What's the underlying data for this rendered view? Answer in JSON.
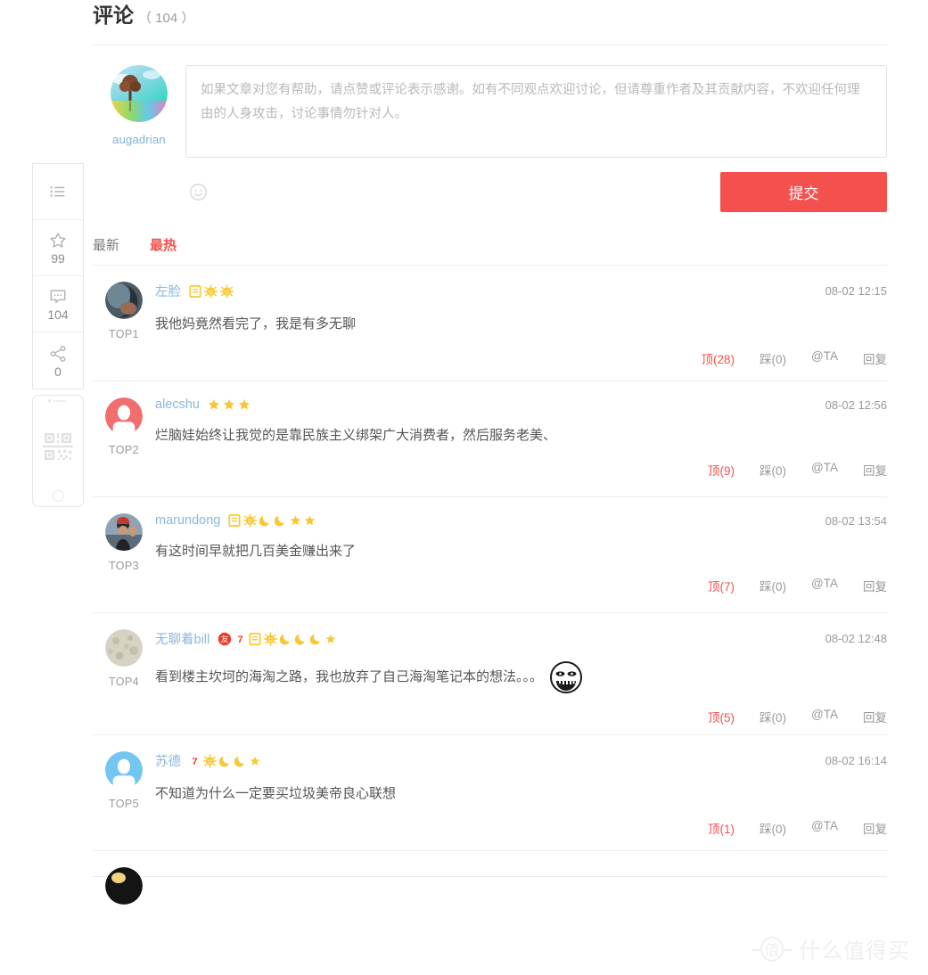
{
  "sidebar": {
    "items": [
      {
        "name": "catalog",
        "icon": "list-icon",
        "count": ""
      },
      {
        "name": "favorite",
        "icon": "star-icon",
        "count": "99"
      },
      {
        "name": "comment",
        "icon": "comment-icon",
        "count": "104"
      },
      {
        "name": "share",
        "icon": "share-icon",
        "count": "0"
      }
    ],
    "phone_widget": {
      "icon": "qrcode-icon"
    }
  },
  "section": {
    "title": "评论",
    "count": "（ 104 ）"
  },
  "composer": {
    "username": "augadrian",
    "avatar": "user-avatar-augadrian",
    "placeholder": "如果文章对您有帮助，请点赞或评论表示感谢。如有不同观点欢迎讨论，但请尊重作者及其贡献内容，不欢迎任何理由的人身攻击，讨论事情勿针对人。",
    "value": "",
    "emoji_icon": "smiley-icon",
    "submit_label": "提交"
  },
  "tabs": [
    {
      "label": "最新",
      "active": false
    },
    {
      "label": "最热",
      "active": true
    }
  ],
  "actions_labels": {
    "down": "踩",
    "mention": "@TA",
    "reply": "回复"
  },
  "comments": [
    {
      "rank": "TOP1",
      "username": "左脸",
      "avatar_type": "photo-dark-blue",
      "badges": [
        "yellow-square-badge",
        "sun-badge",
        "sun-badge"
      ],
      "date": "08-02 12:15",
      "text": "我他妈竟然看完了，我是有多无聊",
      "emoticon": "",
      "up": "顶(28)",
      "down": "踩(0)",
      "mention": "@TA",
      "reply": "回复"
    },
    {
      "rank": "TOP2",
      "username": "alecshu",
      "avatar_type": "default-red",
      "badges": [
        "star-badge",
        "star-badge",
        "star-badge"
      ],
      "date": "08-02 12:56",
      "text": "烂脑娃始终让我觉的是靠民族主义绑架广大消费者，然后服务老美、",
      "emoticon": "",
      "up": "顶(9)",
      "down": "踩(0)",
      "mention": "@TA",
      "reply": "回复"
    },
    {
      "rank": "TOP3",
      "username": "marundong",
      "avatar_type": "photo-person",
      "badges": [
        "yellow-square-badge",
        "sun-badge",
        "moon-badge",
        "moon-badge",
        "star-badge",
        "star-badge"
      ],
      "date": "08-02 13:54",
      "text": "有这时间早就把几百美金赚出来了",
      "emoticon": "",
      "up": "顶(7)",
      "down": "踩(0)",
      "mention": "@TA",
      "reply": "回复"
    },
    {
      "rank": "TOP4",
      "username": "无聊着bill",
      "avatar_type": "photo-moon",
      "badges": [
        "friend-circle-badge",
        "seven-badge",
        "yellow-square-badge",
        "sun-badge",
        "moon-badge",
        "moon-badge",
        "moon-badge",
        "star-badge"
      ],
      "date": "08-02 12:48",
      "text": "看到楼主坎坷的海淘之路，我也放弃了自己海淘笔记本的想法。。。",
      "emoticon": "grin-face-emoticon",
      "up": "顶(5)",
      "down": "踩(0)",
      "mention": "@TA",
      "reply": "回复"
    },
    {
      "rank": "TOP5",
      "username": "苏德",
      "avatar_type": "default-blue",
      "badges": [
        "seven-badge",
        "sun-badge",
        "moon-badge",
        "moon-badge",
        "star-badge"
      ],
      "date": "08-02 16:14",
      "text": "不知道为什么一定要买垃圾美帝良心联想",
      "emoticon": "",
      "up": "顶(1)",
      "down": "踩(0)",
      "mention": "@TA",
      "reply": "回复"
    }
  ],
  "watermark": {
    "logo": "zhi-circle-logo",
    "text": "什么值得买"
  },
  "colors": {
    "accent_red": "#f4504d",
    "link_blue": "#8ab7dd",
    "badge_yellow": "#f8c833",
    "text_gray": "#555555",
    "muted_gray": "#9a9a9a"
  }
}
